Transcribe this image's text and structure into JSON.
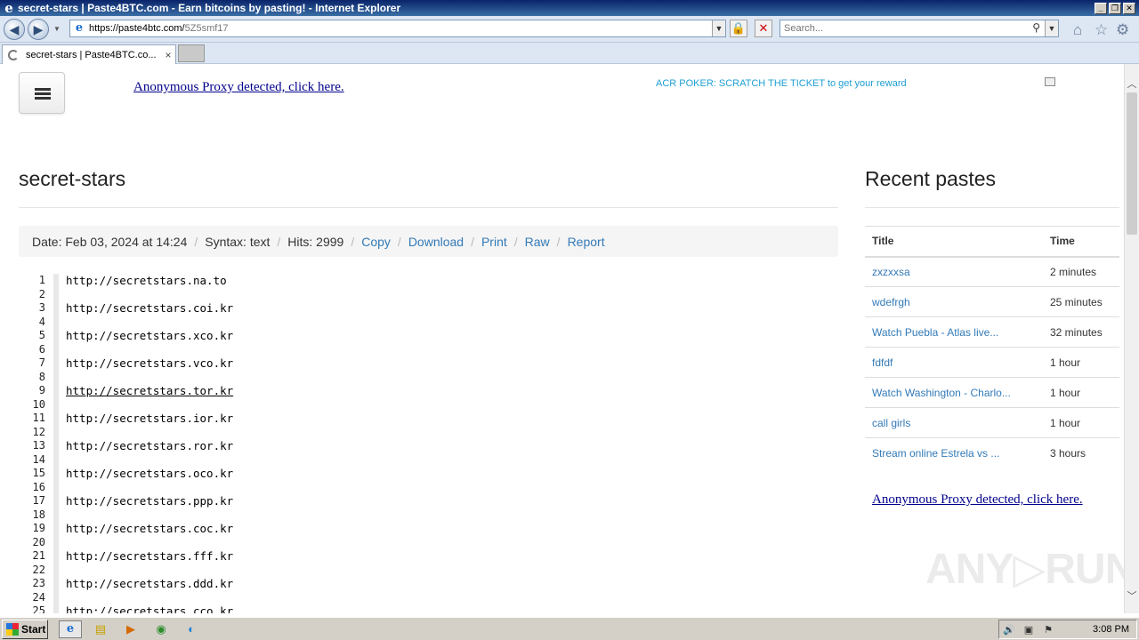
{
  "window": {
    "title": "secret-stars | Paste4BTC.com - Earn bitcoins by pasting! - Internet Explorer",
    "minimize": "_",
    "restore": "❐",
    "close": "✕"
  },
  "navbar": {
    "url_host": "https://paste4btc.com/",
    "url_path": "5Z5smf17",
    "search_placeholder": "Search...",
    "icons": [
      "back-icon",
      "forward-icon",
      "lock-icon",
      "stop-icon",
      "home-icon",
      "favorites-icon",
      "tools-icon"
    ]
  },
  "tabs": [
    {
      "label": "secret-stars | Paste4BTC.co...",
      "close": "×"
    }
  ],
  "page": {
    "proxy_link_top": "Anonymous Proxy detected, click here.",
    "ad_text": "ACR POKER: SCRATCH THE TICKET to get your reward",
    "paste_title": "secret-stars",
    "info": {
      "date": "Date: Feb 03, 2024 at 14:24",
      "syntax": "Syntax: text",
      "hits": "Hits: 2999",
      "sep": "/",
      "links": [
        "Copy",
        "Download",
        "Print",
        "Raw",
        "Report"
      ]
    },
    "code_lines": [
      "http://secretstars.na.to",
      "",
      "http://secretstars.coi.kr",
      "",
      "http://secretstars.xco.kr",
      "",
      "http://secretstars.vco.kr",
      "",
      "http://secretstars.tor.kr",
      "",
      "http://secretstars.ior.kr",
      "",
      "http://secretstars.ror.kr",
      "",
      "http://secretstars.oco.kr",
      "",
      "http://secretstars.ppp.kr",
      "",
      "http://secretstars.coc.kr",
      "",
      "http://secretstars.fff.kr",
      "",
      "http://secretstars.ddd.kr",
      "",
      "http://secretstars.cco.kr"
    ],
    "underlined_line": 9,
    "recent": {
      "title": "Recent pastes",
      "col_title": "Title",
      "col_time": "Time",
      "rows": [
        {
          "title": "zxzxxsa",
          "time": "2 minutes"
        },
        {
          "title": "wdefrgh",
          "time": "25 minutes"
        },
        {
          "title": "Watch Puebla - Atlas live...",
          "time": "32 minutes"
        },
        {
          "title": "fdfdf",
          "time": "1 hour"
        },
        {
          "title": "Watch Washington - Charlo...",
          "time": "1 hour"
        },
        {
          "title": "call girls",
          "time": "1 hour"
        },
        {
          "title": "Stream online Estrela vs ...",
          "time": "3 hours"
        }
      ]
    },
    "proxy_link_bottom": "Anonymous Proxy detected, click here.",
    "watermark": "ANY▷RUN"
  },
  "taskbar": {
    "start_label": "Start",
    "clock": "3:08 PM"
  }
}
